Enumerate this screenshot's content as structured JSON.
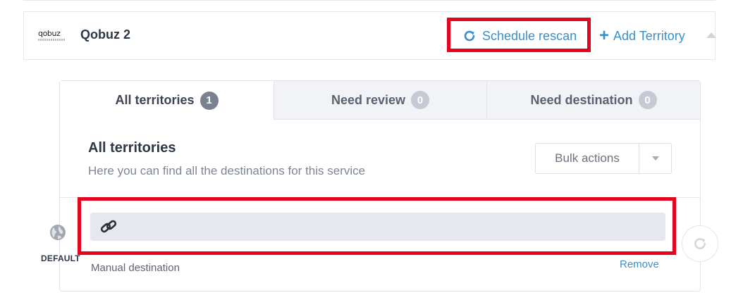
{
  "service": {
    "logo_text": "qobuz",
    "name": "Qobuz 2",
    "schedule_rescan_label": "Schedule rescan",
    "add_territory_label": "Add Territory",
    "add_icon": "+"
  },
  "tabs": [
    {
      "label": "All territories",
      "count": "1",
      "active": true
    },
    {
      "label": "Need review",
      "count": "0",
      "active": false
    },
    {
      "label": "Need destination",
      "count": "0",
      "active": false
    }
  ],
  "section": {
    "title": "All territories",
    "description": "Here you can find all the destinations for this service",
    "bulk_actions_label": "Bulk actions"
  },
  "destination": {
    "territory_label": "DEFAULT",
    "value": "",
    "type_label": "Manual destination",
    "remove_label": "Remove"
  },
  "colors": {
    "accent": "#3b8fc9",
    "highlight": "#e3061e",
    "field_bg": "#e6e8f0"
  },
  "icons": [
    "refresh-icon",
    "plus-icon",
    "collapse-icon",
    "globe-icon",
    "link-icon",
    "caret-down-icon"
  ]
}
